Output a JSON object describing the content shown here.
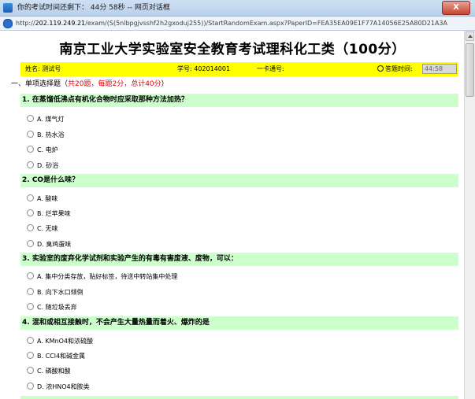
{
  "window": {
    "title": "你的考试时间还剩下：  44分 58秒  -- 网页对话框",
    "close_label": "X"
  },
  "address": {
    "prefix": "http://",
    "host": "202.119.249.21",
    "path": "/exam/(S(5nlbpgjvsshf2h2gxoduj255))/StartRandomExam.aspx?PaperID=FEA35EA09E1F77A14056E25A80D21A3A"
  },
  "exam": {
    "title": "南京工业大学实验室安全教育考试理科化工类（100分）",
    "name_label": "姓名: 测试号",
    "student_id": "学号:  402014001",
    "card_label": "一卡通号:",
    "time_label": "答题时间:",
    "time_value": "44:58"
  },
  "section": {
    "prefix": "一、单项选择题（",
    "detail": "共20题，每题2分，总计40分",
    "suffix": "）"
  },
  "questions": [
    {
      "text": "1. 在蒸馏低沸点有机化合物时应采取那种方法加热？",
      "options": [
        "A. 煤气灯",
        "B. 热水浴",
        "C. 电炉",
        "D. 砂浴"
      ]
    },
    {
      "text": "2. CO是什么味？",
      "options": [
        "A. 酸味",
        "B. 烂苹果味",
        "C. 无味",
        "D. 臭鸡蛋味"
      ]
    },
    {
      "text": "3. 实验室的废弃化学试剂和实验产生的有毒有害废液、废物，可以：",
      "options": [
        "A. 集中分类存放，贴好标签，待送中转站集中处理",
        "B. 向下水口倾倒",
        "C. 随垃圾丢弃"
      ]
    },
    {
      "text": "4. 混和或相互接触时，不会产生大量热量而着火、爆炸的是",
      "options": [
        "A. KMnO4和浓硫酸",
        "B. CCl4和碱金属",
        "C. 磷酸和酸",
        "D. 浓HNO4和胺类"
      ]
    }
  ]
}
